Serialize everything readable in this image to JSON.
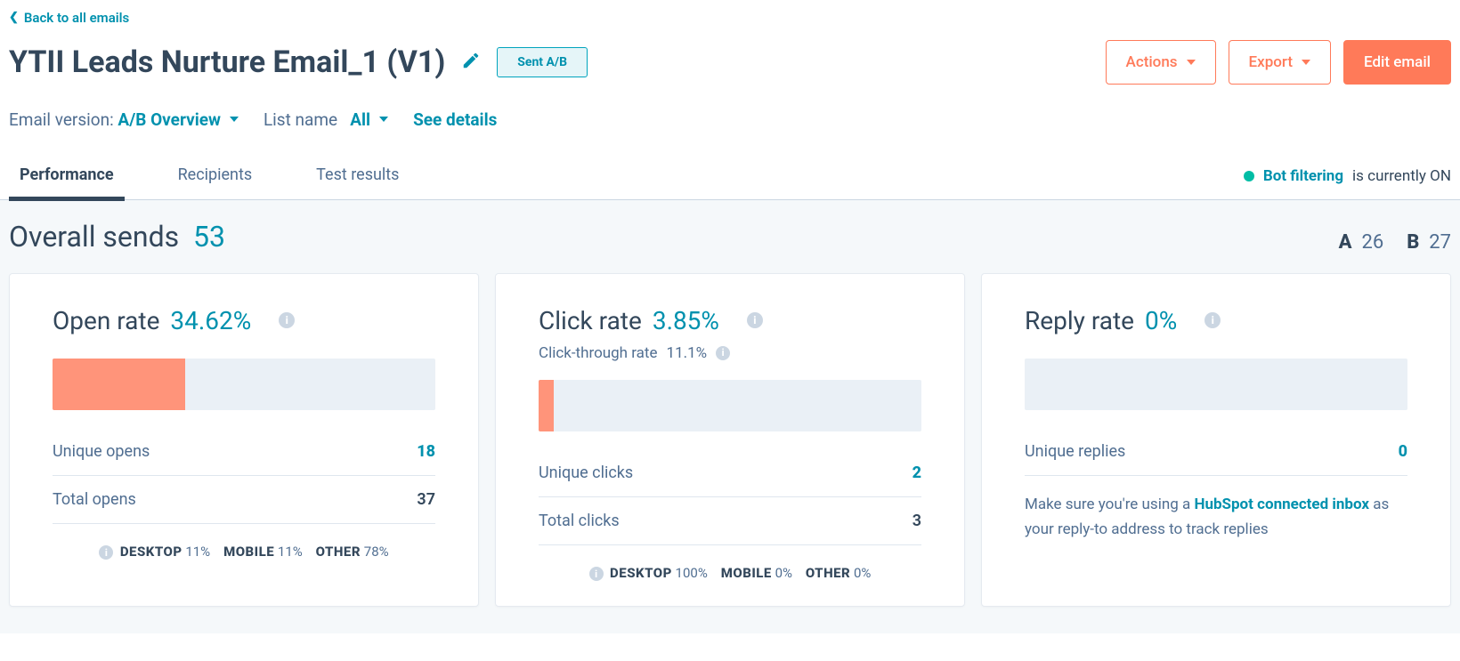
{
  "nav": {
    "back_label": "Back to all emails"
  },
  "header": {
    "title": "YTII Leads Nurture Email_1 (V1)",
    "badge": "Sent A/B",
    "actions_btn": "Actions",
    "export_btn": "Export",
    "edit_btn": "Edit email"
  },
  "filters": {
    "email_version_label": "Email version:",
    "email_version_value": "A/B Overview",
    "list_name_label": "List name",
    "list_name_value": "All",
    "see_details": "See details"
  },
  "tabs": {
    "performance": "Performance",
    "recipients": "Recipients",
    "test_results": "Test results"
  },
  "bot_filter": {
    "link_text": "Bot filtering",
    "suffix": "is currently ON"
  },
  "overall": {
    "label": "Overall sends",
    "count": "53",
    "a_label": "A",
    "a_count": "26",
    "b_label": "B",
    "b_count": "27"
  },
  "cards": {
    "open": {
      "title": "Open rate",
      "value": "34.62%",
      "bar_pct": 34.62,
      "unique_label": "Unique opens",
      "unique_value": "18",
      "total_label": "Total opens",
      "total_value": "37",
      "break": {
        "desktop_label": "DESKTOP",
        "desktop": "11%",
        "mobile_label": "MOBILE",
        "mobile": "11%",
        "other_label": "OTHER",
        "other": "78%"
      }
    },
    "click": {
      "title": "Click rate",
      "value": "3.85%",
      "ctr_label": "Click-through rate",
      "ctr_value": "11.1%",
      "bar_pct": 3.85,
      "unique_label": "Unique clicks",
      "unique_value": "2",
      "total_label": "Total clicks",
      "total_value": "3",
      "break": {
        "desktop_label": "DESKTOP",
        "desktop": "100%",
        "mobile_label": "MOBILE",
        "mobile": "0%",
        "other_label": "OTHER",
        "other": "0%"
      }
    },
    "reply": {
      "title": "Reply rate",
      "value": "0%",
      "bar_pct": 0,
      "unique_label": "Unique replies",
      "unique_value": "0",
      "note_prefix": "Make sure you're using a ",
      "note_link": "HubSpot connected inbox",
      "note_suffix": " as your reply-to address to track replies"
    }
  },
  "chart_data": [
    {
      "type": "bar",
      "title": "Open rate",
      "categories": [
        "Open rate"
      ],
      "values": [
        34.62
      ],
      "xlabel": "",
      "ylabel": "%",
      "ylim": [
        0,
        100
      ]
    },
    {
      "type": "bar",
      "title": "Click rate",
      "categories": [
        "Click rate"
      ],
      "values": [
        3.85
      ],
      "xlabel": "",
      "ylabel": "%",
      "ylim": [
        0,
        100
      ]
    },
    {
      "type": "bar",
      "title": "Reply rate",
      "categories": [
        "Reply rate"
      ],
      "values": [
        0
      ],
      "xlabel": "",
      "ylabel": "%",
      "ylim": [
        0,
        100
      ]
    }
  ]
}
